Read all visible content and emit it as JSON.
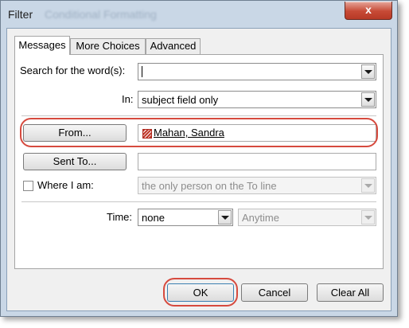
{
  "window": {
    "title": "Filter",
    "background_title": "Conditional Formatting",
    "close_glyph": "x"
  },
  "tabs": [
    {
      "label": "Messages",
      "active": true
    },
    {
      "label": "More Choices",
      "active": false
    },
    {
      "label": "Advanced",
      "active": false
    }
  ],
  "messages": {
    "search_label": "Search for the word(s):",
    "search_value": "",
    "in_label": "In:",
    "in_value": "subject field only",
    "from_button": "From...",
    "from_value": "Mahan, Sandra",
    "sent_to_button": "Sent To...",
    "sent_to_value": "",
    "where_label": "Where I am:",
    "where_checked": false,
    "where_value": "the only person on the To line",
    "time_label": "Time:",
    "time_value": "none",
    "time_range_value": "Anytime"
  },
  "footer": {
    "ok": "OK",
    "cancel": "Cancel",
    "clear_all": "Clear All"
  },
  "colors": {
    "highlight_ring": "#d64a3e",
    "close_button": "#c74a36",
    "window_frame": "#c9d7e6"
  }
}
